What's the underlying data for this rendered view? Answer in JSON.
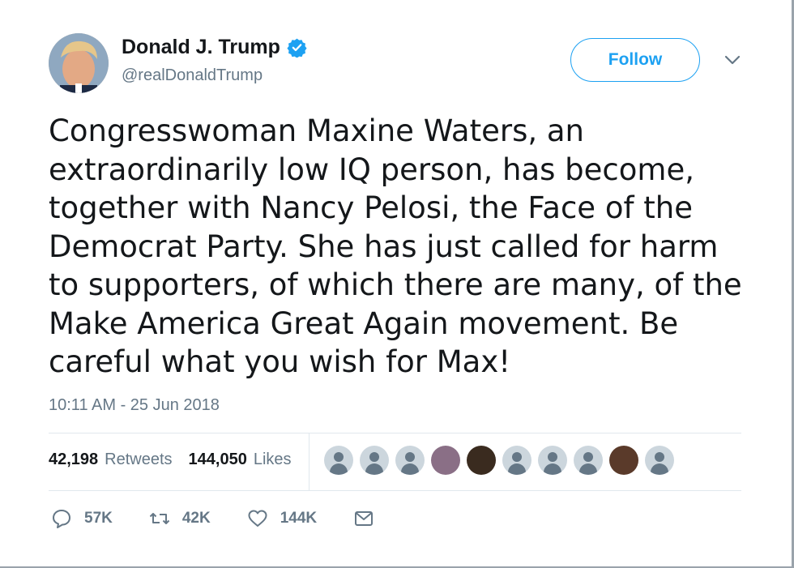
{
  "author": {
    "name": "Donald J. Trump",
    "handle": "@realDonaldTrump",
    "verified_icon": "verified-badge-icon"
  },
  "header": {
    "follow_label": "Follow",
    "menu_icon": "chevron-down-icon"
  },
  "tweet": {
    "lines": [
      "Congresswoman Maxine Waters, an",
      "extraordinarily low IQ person, has become,",
      "together with Nancy Pelosi, the Face of the",
      "Democrat Party. She has just called for harm",
      "to supporters, of which there are many, of the",
      "Make America Great Again movement. Be",
      "careful what you wish for Max!"
    ],
    "timestamp": "10:11 AM - 25 Jun 2018"
  },
  "stats": {
    "retweets_count": "42,198",
    "retweets_label": "Retweets",
    "likes_count": "144,050",
    "likes_label": "Likes"
  },
  "likers": [
    {
      "type": "default"
    },
    {
      "type": "default"
    },
    {
      "type": "default"
    },
    {
      "type": "photo-a"
    },
    {
      "type": "photo-b"
    },
    {
      "type": "default"
    },
    {
      "type": "default"
    },
    {
      "type": "default"
    },
    {
      "type": "photo-c"
    },
    {
      "type": "default"
    }
  ],
  "actions": {
    "reply_count": "57K",
    "retweet_count": "42K",
    "like_count": "144K"
  },
  "colors": {
    "accent": "#1da1f2",
    "secondary_text": "#657786",
    "divider": "#e1e8ed"
  }
}
